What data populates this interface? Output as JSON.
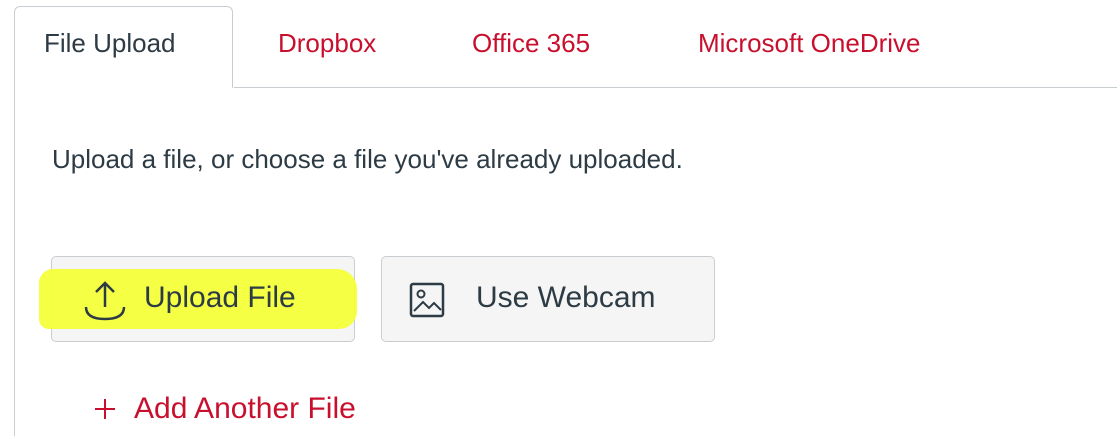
{
  "tabs": [
    {
      "label": "File Upload",
      "active": true
    },
    {
      "label": "Dropbox",
      "active": false
    },
    {
      "label": "Office 365",
      "active": false
    },
    {
      "label": "Microsoft OneDrive",
      "active": false
    }
  ],
  "panel": {
    "instructions": "Upload a file, or choose a file you've already uploaded.",
    "upload_button": {
      "label": "Upload File",
      "icon": "upload-icon"
    },
    "webcam_button": {
      "label": "Use Webcam",
      "icon": "image-icon"
    },
    "add_another": {
      "label": "Add Another File",
      "icon": "plus-icon"
    }
  },
  "colors": {
    "accent": "#c8102e",
    "text": "#2d3b45",
    "border": "#c7cdd1",
    "highlight": "#f4ff3a",
    "button_bg": "#f5f5f5"
  }
}
